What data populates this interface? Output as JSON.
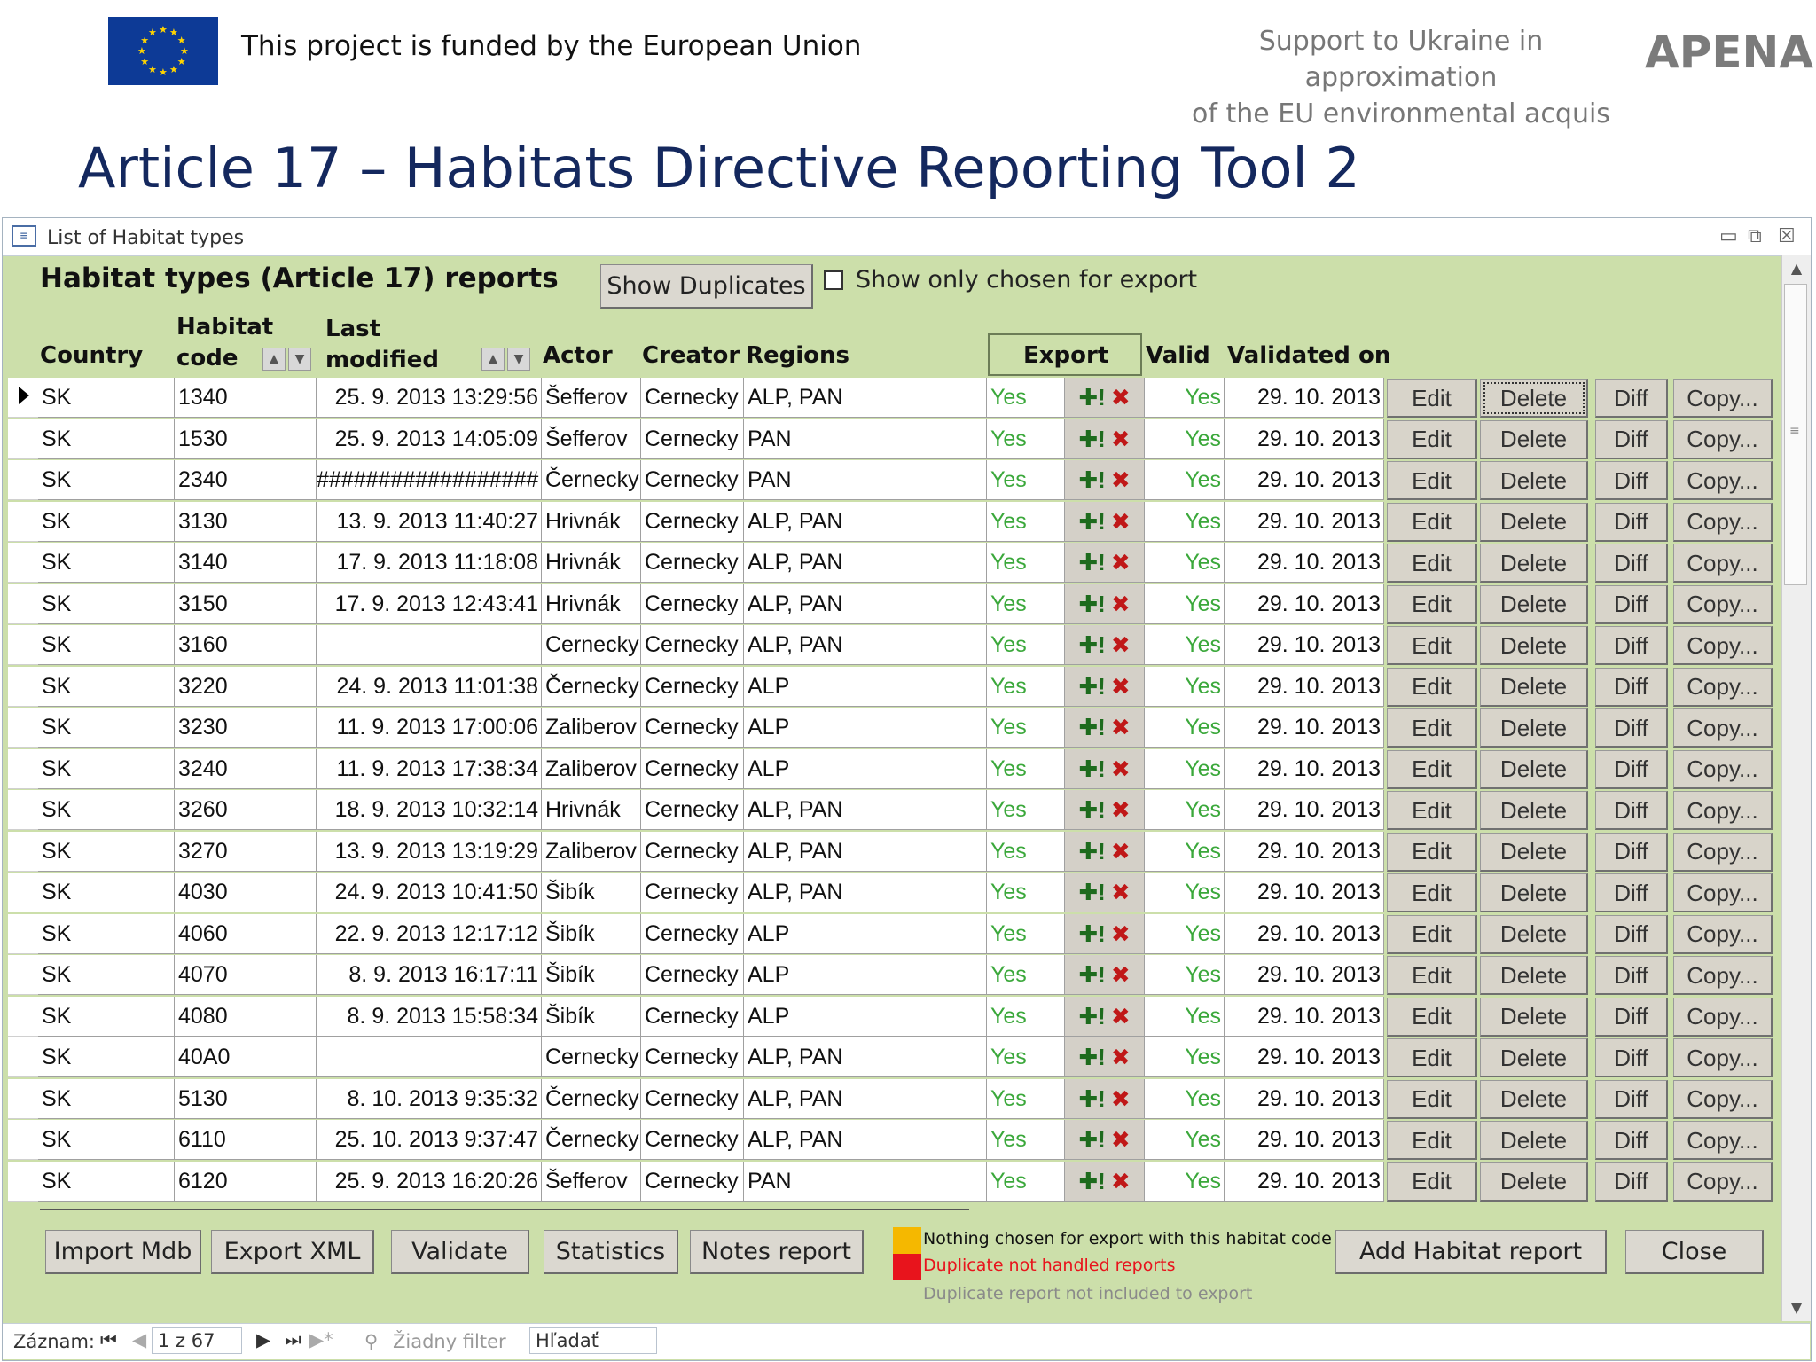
{
  "slide": {
    "funded_text": "This project is funded by the European Union",
    "support_line1": "Support to Ukraine in approximation",
    "support_line2": "of the EU environmental acquis",
    "brand": "APENA",
    "title": "Article 17 – Habitats Directive Reporting Tool 2",
    "colors": {
      "title": "#14285e",
      "flag": "#0d3a96",
      "form_bg": "#ccdfaa"
    }
  },
  "window": {
    "title": "List of Habitat types",
    "heading": "Habitat types (Article 17) reports",
    "show_duplicates": "Show Duplicates",
    "show_only_chosen": "Show only chosen for export",
    "show_only_chosen_checked": false
  },
  "columns": {
    "country": "Country",
    "habitat_1": "Habitat",
    "habitat_2": "code",
    "last_1": "Last",
    "last_2": "modified",
    "actor": "Actor",
    "creator": "Creator",
    "regions": "Regions",
    "export": "Export",
    "valid": "Valid",
    "validated_on": "Validated on"
  },
  "row_buttons": {
    "edit": "Edit",
    "delete": "Delete",
    "diff": "Diff",
    "copy": "Copy..."
  },
  "row_icons": {
    "include": "plus-exclamation-icon",
    "exclude": "cross-icon"
  },
  "rows": [
    {
      "country": "SK",
      "code": "1340",
      "modified": "25. 9. 2013 13:29:56",
      "actor": "Šefferov",
      "creator": "Cernecky",
      "regions": "ALP, PAN",
      "export": "Yes",
      "valid": "Yes",
      "validated": "29. 10. 2013"
    },
    {
      "country": "SK",
      "code": "1530",
      "modified": "25. 9. 2013 14:05:09",
      "actor": "Šefferov",
      "creator": "Cernecky",
      "regions": "PAN",
      "export": "Yes",
      "valid": "Yes",
      "validated": "29. 10. 2013"
    },
    {
      "country": "SK",
      "code": "2340",
      "modified": "##################",
      "actor": "Černecky",
      "creator": "Cernecky",
      "regions": "PAN",
      "export": "Yes",
      "valid": "Yes",
      "validated": "29. 10. 2013"
    },
    {
      "country": "SK",
      "code": "3130",
      "modified": "13. 9. 2013 11:40:27",
      "actor": "Hrivnák",
      "creator": "Cernecky",
      "regions": "ALP, PAN",
      "export": "Yes",
      "valid": "Yes",
      "validated": "29. 10. 2013"
    },
    {
      "country": "SK",
      "code": "3140",
      "modified": "17. 9. 2013 11:18:08",
      "actor": "Hrivnák",
      "creator": "Cernecky",
      "regions": "ALP, PAN",
      "export": "Yes",
      "valid": "Yes",
      "validated": "29. 10. 2013"
    },
    {
      "country": "SK",
      "code": "3150",
      "modified": "17. 9. 2013 12:43:41",
      "actor": "Hrivnák",
      "creator": "Cernecky",
      "regions": "ALP, PAN",
      "export": "Yes",
      "valid": "Yes",
      "validated": "29. 10. 2013"
    },
    {
      "country": "SK",
      "code": "3160",
      "modified": "",
      "actor": "Cernecky",
      "creator": "Cernecky",
      "regions": "ALP, PAN",
      "export": "Yes",
      "valid": "Yes",
      "validated": "29. 10. 2013"
    },
    {
      "country": "SK",
      "code": "3220",
      "modified": "24. 9. 2013 11:01:38",
      "actor": "Černecky",
      "creator": "Cernecky",
      "regions": "ALP",
      "export": "Yes",
      "valid": "Yes",
      "validated": "29. 10. 2013"
    },
    {
      "country": "SK",
      "code": "3230",
      "modified": "11. 9. 2013 17:00:06",
      "actor": "Zaliberov",
      "creator": "Cernecky",
      "regions": "ALP",
      "export": "Yes",
      "valid": "Yes",
      "validated": "29. 10. 2013"
    },
    {
      "country": "SK",
      "code": "3240",
      "modified": "11. 9. 2013 17:38:34",
      "actor": "Zaliberov",
      "creator": "Cernecky",
      "regions": "ALP",
      "export": "Yes",
      "valid": "Yes",
      "validated": "29. 10. 2013"
    },
    {
      "country": "SK",
      "code": "3260",
      "modified": "18. 9. 2013 10:32:14",
      "actor": "Hrivnák",
      "creator": "Cernecky",
      "regions": "ALP, PAN",
      "export": "Yes",
      "valid": "Yes",
      "validated": "29. 10. 2013"
    },
    {
      "country": "SK",
      "code": "3270",
      "modified": "13. 9. 2013 13:19:29",
      "actor": "Zaliberov",
      "creator": "Cernecky",
      "regions": "ALP, PAN",
      "export": "Yes",
      "valid": "Yes",
      "validated": "29. 10. 2013"
    },
    {
      "country": "SK",
      "code": "4030",
      "modified": "24. 9. 2013 10:41:50",
      "actor": "Šibík",
      "creator": "Cernecky",
      "regions": "ALP, PAN",
      "export": "Yes",
      "valid": "Yes",
      "validated": "29. 10. 2013"
    },
    {
      "country": "SK",
      "code": "4060",
      "modified": "22. 9. 2013 12:17:12",
      "actor": "Šibík",
      "creator": "Cernecky",
      "regions": "ALP",
      "export": "Yes",
      "valid": "Yes",
      "validated": "29. 10. 2013"
    },
    {
      "country": "SK",
      "code": "4070",
      "modified": "8. 9. 2013 16:17:11",
      "actor": "Šibík",
      "creator": "Cernecky",
      "regions": "ALP",
      "export": "Yes",
      "valid": "Yes",
      "validated": "29. 10. 2013"
    },
    {
      "country": "SK",
      "code": "4080",
      "modified": "8. 9. 2013 15:58:34",
      "actor": "Šibík",
      "creator": "Cernecky",
      "regions": "ALP",
      "export": "Yes",
      "valid": "Yes",
      "validated": "29. 10. 2013"
    },
    {
      "country": "SK",
      "code": "40A0",
      "modified": "",
      "actor": "Cernecky",
      "creator": "Cernecky",
      "regions": "ALP, PAN",
      "export": "Yes",
      "valid": "Yes",
      "validated": "29. 10. 2013"
    },
    {
      "country": "SK",
      "code": "5130",
      "modified": "8. 10. 2013 9:35:32",
      "actor": "Černecky",
      "creator": "Cernecky",
      "regions": "ALP, PAN",
      "export": "Yes",
      "valid": "Yes",
      "validated": "29. 10. 2013"
    },
    {
      "country": "SK",
      "code": "6110",
      "modified": "25. 10. 2013 9:37:47",
      "actor": "Černecky",
      "creator": "Cernecky",
      "regions": "ALP, PAN",
      "export": "Yes",
      "valid": "Yes",
      "validated": "29. 10. 2013"
    },
    {
      "country": "SK",
      "code": "6120",
      "modified": "25. 9. 2013 16:20:26",
      "actor": "Šefferov",
      "creator": "Cernecky",
      "regions": "PAN",
      "export": "Yes",
      "valid": "Yes",
      "validated": "29. 10. 2013"
    }
  ],
  "footer": {
    "import_mdb": "Import Mdb",
    "export_xml": "Export XML",
    "validate": "Validate",
    "statistics": "Statistics",
    "notes_report": "Notes report",
    "add_habitat_report": "Add Habitat report",
    "close": "Close",
    "legend": [
      {
        "text": "Nothing chosen for export with this habitat code",
        "color": "#f5b800",
        "text_color": "#111111"
      },
      {
        "text": "Duplicate not handled reports",
        "color": "#e8141c",
        "text_color": "#e8141c"
      },
      {
        "text": "Duplicate report not included to export",
        "color": "",
        "text_color": "#8a8a8a"
      }
    ]
  },
  "navbar": {
    "record_label": "Záznam:",
    "record_position": "1 z 67",
    "filter": "Žiadny filter",
    "search": "Hľadať"
  }
}
